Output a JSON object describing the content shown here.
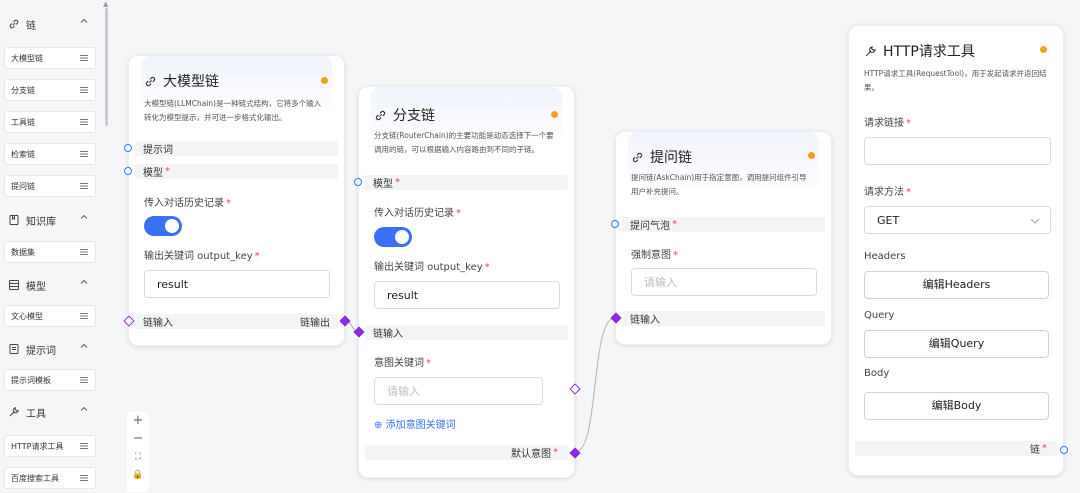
{
  "sidebar": {
    "groups": [
      {
        "label": "链",
        "icon": "link-icon"
      },
      {
        "label": "知识库",
        "icon": "book-icon"
      },
      {
        "label": "模型",
        "icon": "list-icon"
      },
      {
        "label": "提示词",
        "icon": "doc-icon"
      },
      {
        "label": "工具",
        "icon": "wrench-icon"
      }
    ],
    "items": [
      "大模型链",
      "分支链",
      "工具链",
      "检索链",
      "提问链",
      "数据集",
      "文心模型",
      "提示词模板",
      "HTTP请求工具",
      "百度搜索工具"
    ]
  },
  "zoom": {
    "plus": "+",
    "minus": "−",
    "fit": "⛶",
    "lock": "🔒"
  },
  "nodes": {
    "llm": {
      "title": "大模型链",
      "desc1": "大模型链(LLMChain)是一种链式结构，它将多个输入",
      "desc2": "转化为模型提示，并可进一步格式化输出。",
      "port_prompt": "提示词",
      "port_model": "模型",
      "history_label": "传入对话历史记录",
      "output_key_label": "输出关键词 output_key",
      "output_key_value": "result",
      "chain_in": "链输入",
      "chain_out": "链输出"
    },
    "router": {
      "title": "分支链",
      "desc1": "分支链(RouterChain)的主要功能是动态选择下一个要",
      "desc2": "调用的链，可以根据输入内容路由到不同的子链。",
      "port_model": "模型",
      "history_label": "传入对话历史记录",
      "output_key_label": "输出关键词 output_key",
      "output_key_value": "result",
      "chain_in": "链输入",
      "intent_label": "意图关键词",
      "intent_placeholder": "请输入",
      "add_intent": "添加意图关键词",
      "default_intent": "默认意图"
    },
    "ask": {
      "title": "提问链",
      "desc1": "提问链(AskChain)用于指定意图，调用提问组件引导",
      "desc2": "用户补充提问。",
      "port_bubble": "提问气泡",
      "force_intent_label": "强制意图",
      "force_intent_placeholder": "请输入",
      "chain_in": "链输入"
    },
    "http": {
      "title": "HTTP请求工具",
      "desc1": "HTTP请求工具(RequestTool)，用于发起请求并返回结",
      "desc2": "果。",
      "url_label": "请求链接",
      "method_label": "请求方法",
      "method_value": "GET",
      "headers_label": "Headers",
      "headers_btn": "编辑Headers",
      "query_label": "Query",
      "query_btn": "编辑Query",
      "body_label": "Body",
      "body_btn": "编辑Body",
      "chain_out": "链"
    }
  },
  "colors": {
    "accent": "#3b6ff5",
    "port_blue": "#2b7de9",
    "port_purple": "#8a2be2",
    "status": "#f0a020",
    "required": "#e54d42"
  }
}
